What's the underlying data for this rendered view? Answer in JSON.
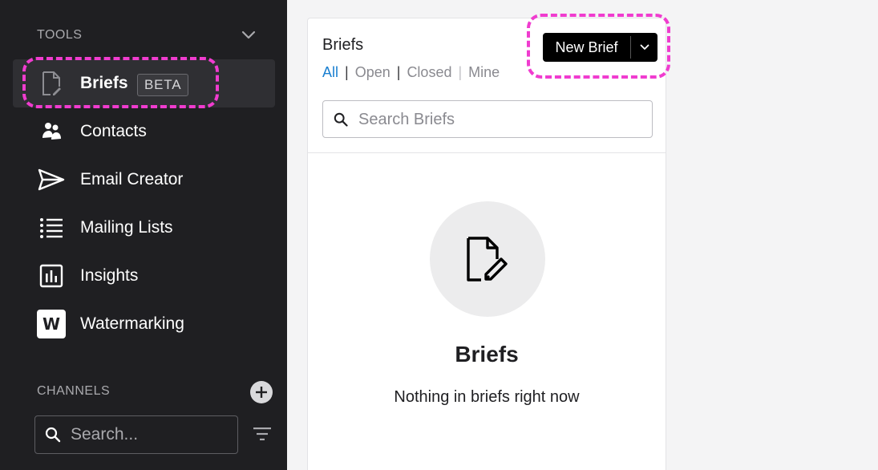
{
  "sidebar": {
    "tools_heading": "TOOLS",
    "channels_heading": "CHANNELS",
    "items": [
      {
        "label": "Briefs",
        "icon": "brief-document-icon",
        "badge": "BETA",
        "active": true
      },
      {
        "label": "Contacts",
        "icon": "contacts-icon"
      },
      {
        "label": "Email Creator",
        "icon": "send-icon"
      },
      {
        "label": "Mailing Lists",
        "icon": "list-icon"
      },
      {
        "label": "Insights",
        "icon": "bar-chart-icon"
      },
      {
        "label": "Watermarking",
        "icon": "watermark-w-icon",
        "icon_text": "W"
      }
    ],
    "channel_search": {
      "placeholder": "Search..."
    }
  },
  "briefs_panel": {
    "title": "Briefs",
    "filters": [
      "All",
      "Open",
      "Closed",
      "Mine"
    ],
    "active_filter": "All",
    "new_button": "New Brief",
    "search": {
      "placeholder": "Search Briefs"
    },
    "empty_state": {
      "title": "Briefs",
      "message": "Nothing in briefs right now"
    }
  },
  "colors": {
    "sidebar_bg": "#1f1f22",
    "active_item_bg": "#2f2f33",
    "highlight": "#f03ccf",
    "link_active": "#1a7fd0",
    "button_bg": "#000000"
  }
}
